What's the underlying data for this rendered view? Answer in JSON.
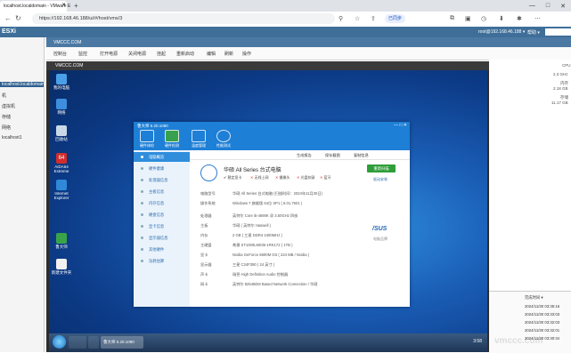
{
  "browser": {
    "tab_title": "localhost.localdomain - VMware E",
    "url": "https://192.168.46.188/ui/#/host/vms/3",
    "profile_label": "已同步",
    "new_tab": "+"
  },
  "esxi": {
    "logo": "ESXi",
    "user": "root@192.168.46.188 ▾",
    "help": "帮助 ▾",
    "nav_items": [
      "localhost.localdomain",
      "机",
      "虚拟机",
      "存储",
      "网络",
      "localhost1"
    ]
  },
  "vm": {
    "name": "VMCCC.COM",
    "console_title": "VMCCC.COM",
    "tools": [
      "控制台",
      "监控",
      "打开电源",
      "关闭电源",
      "挂起",
      "重新启动",
      "编辑",
      "刷新",
      "操作"
    ]
  },
  "desktop": {
    "icons": [
      {
        "label": "我的电脑",
        "color": "#4aa0e8"
      },
      {
        "label": "网络",
        "color": "#3d8ede"
      },
      {
        "label": "回收站",
        "color": "#c9d9e8"
      },
      {
        "label": "AIDA64 Extreme",
        "color": "#d12d2d"
      },
      {
        "label": "Internet Explorer",
        "color": "#2f88d8"
      },
      {
        "label": "鲁大师",
        "color": "#3aa34a"
      },
      {
        "label": "新建文件夹",
        "color": "#f0f0f0"
      }
    ],
    "taskbar_active": "鲁大师 5.20.1080",
    "clock": "3:58"
  },
  "dialog": {
    "title": "鲁大师 5.20.1080",
    "tabs": [
      "硬件体检",
      "硬件检测",
      "温度管理",
      "性能测试"
    ],
    "sidebar": [
      "电脑概览",
      "硬件健康",
      "处理器信息",
      "主板信息",
      "内存信息",
      "硬盘信息",
      "显卡信息",
      "显示器信息",
      "其他硬件",
      "功耗估算"
    ],
    "actions": [
      "生成报告",
      "保存截图",
      "复制信息"
    ],
    "computer_name": "华硕 All Series 台式电脑",
    "checks": [
      "稳定显卡",
      "无线上网",
      "摄像头",
      "光盘刻录",
      "蓝牙"
    ],
    "button": "重新扫描",
    "link": "驱动安装",
    "brand": "/SUS",
    "brand_sub": "电脑品牌",
    "specs": [
      {
        "k": "电脑型号",
        "v": "华硕 All Series 台式电脑 (扫描时间：2024年11月30日)"
      },
      {
        "k": "操作系统",
        "v": "Windows 7 旗舰版 64位 SP1 ( 6.01.7601 )"
      },
      {
        "k": "处理器",
        "v": "英特尔 Core i5-4690K @ 3.50GHz 四核"
      },
      {
        "k": "主板",
        "v": "华硕 ( 英特尔 Haswell )"
      },
      {
        "k": "内存",
        "v": "2 GB ( 三星 DDR4 2400MHz )"
      },
      {
        "k": "主硬盘",
        "v": "希捷 ST1000LM035-1RK172 ( 1TB )"
      },
      {
        "k": "显卡",
        "v": "Nvidia GeForce 8600M GS ( 224 MB / Nvidia )"
      },
      {
        "k": "显示器",
        "v": "三星 C24F390 ( 24 英寸 )"
      },
      {
        "k": "声卡",
        "v": "瑞昱 High Definition Audio 控制器"
      },
      {
        "k": "网卡",
        "v": "英特尔 82545EM Based Network Connection / 华硕"
      }
    ]
  },
  "right": {
    "metrics": [
      "CPU",
      "2.3 GHz",
      "内存",
      "2.18 GB",
      "存储",
      "11.17 GB"
    ],
    "table_header": "完成时间 ▾",
    "table_rows": [
      "2024/11/30 03:35:16",
      "2024/11/30 03:33:03",
      "2024/11/30 03:32:03",
      "2024/11/30 03:32:01",
      "2024/11/30 03:30:34"
    ],
    "watermark": "vmccc.com"
  }
}
